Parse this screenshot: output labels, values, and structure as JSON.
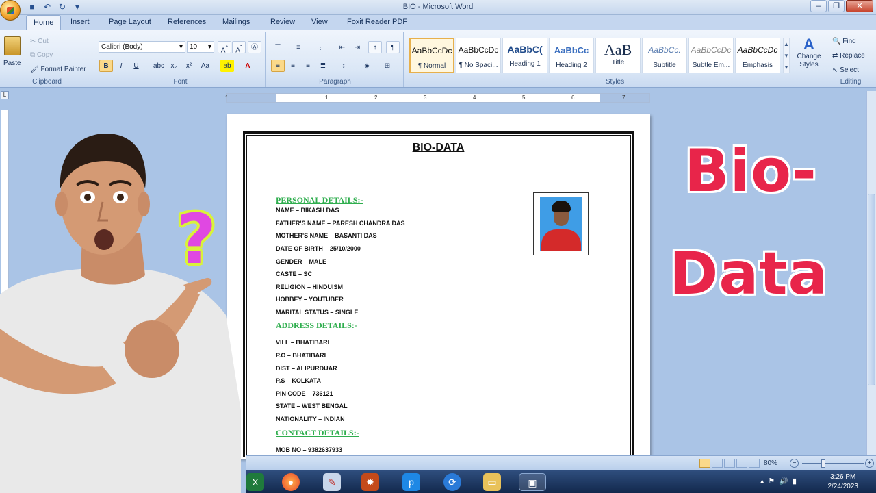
{
  "window": {
    "title": "BIO - Microsoft Word"
  },
  "tabs": [
    "Home",
    "Insert",
    "Page Layout",
    "References",
    "Mailings",
    "Review",
    "View",
    "Foxit Reader PDF"
  ],
  "clipboard": {
    "paste": "Paste",
    "cut": "Cut",
    "copy": "Copy",
    "format_painter": "Format Painter",
    "label": "Clipboard"
  },
  "font": {
    "name": "Calibri (Body)",
    "size": "10",
    "label": "Font"
  },
  "paragraph": {
    "label": "Paragraph"
  },
  "styles": {
    "label": "Styles",
    "items": [
      {
        "sample": "AaBbCcDc",
        "name": "¶ Normal"
      },
      {
        "sample": "AaBbCcDc",
        "name": "¶ No Spaci..."
      },
      {
        "sample": "AaBbC(",
        "name": "Heading 1"
      },
      {
        "sample": "AaBbCc",
        "name": "Heading 2"
      },
      {
        "sample": "AaB",
        "name": "Title"
      },
      {
        "sample": "AaBbCc.",
        "name": "Subtitle"
      },
      {
        "sample": "AaBbCcDc",
        "name": "Subtle Em..."
      },
      {
        "sample": "AaBbCcDc",
        "name": "Emphasis"
      }
    ],
    "change_styles": "Change Styles"
  },
  "editing": {
    "find": "Find",
    "replace": "Replace",
    "select": "Select",
    "label": "Editing"
  },
  "document": {
    "title": "BIO-DATA",
    "personal_heading": "PERSONAL DETAILS:-",
    "personal": [
      "NAME – BIKASH DAS",
      "FATHER'S NAME – PARESH CHANDRA DAS",
      "MOTHER'S NAME – BASANTI DAS",
      "DATE OF BIRTH – 25/10/2000",
      "GENDER – MALE",
      "CASTE – SC",
      "RELIGION – HINDUISM",
      "HOBBEY – YOUTUBER",
      "MARITAL STATUS – SINGLE"
    ],
    "address_heading": "ADDRESS DETAILS:-",
    "address": [
      "VILL – BHATIBARI",
      "P.O – BHATIBARI",
      "DIST – ALIPURDUAR",
      "P.S – KOLKATA",
      "PIN CODE – 736121",
      "STATE – WEST BENGAL",
      "NATIONALITY – INDIAN"
    ],
    "contact_heading": "CONTACT DETAILS:-",
    "contact": [
      "MOB NO – 9382637933"
    ]
  },
  "overlay": {
    "line1": "Bio-",
    "line2": "Data",
    "question": "?"
  },
  "status": {
    "zoom": "80%"
  },
  "clock": {
    "time": "3:26 PM",
    "date": "2/24/2023"
  },
  "colors": {
    "accent_red": "#e8254a",
    "section_green": "#2fae4e",
    "question_magenta": "#e048e2"
  }
}
